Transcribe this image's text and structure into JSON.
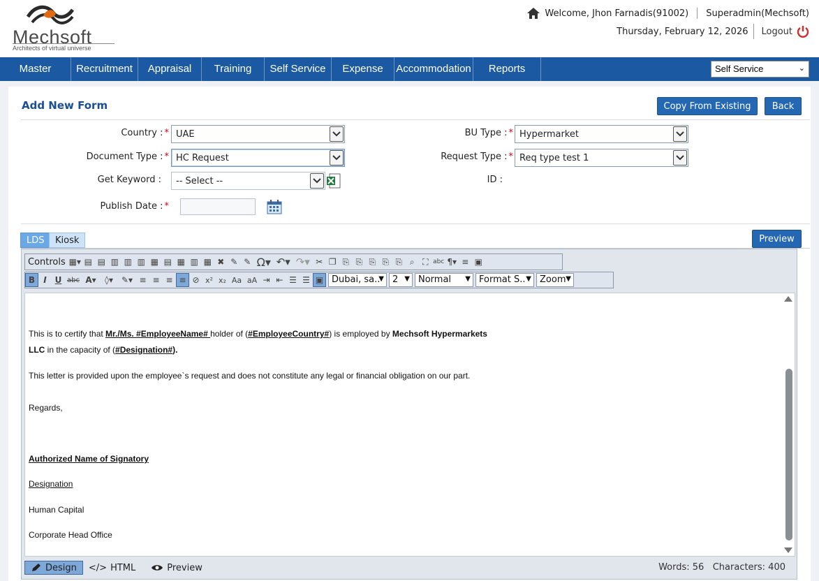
{
  "header": {
    "logo_name": "Mechsoft",
    "logo_tagline": "Architects of virtual universe",
    "welcome": "Welcome, Jhon Farnadis(91002)",
    "role": "Superadmin(Mechsoft)",
    "date": "Thursday, February 12, 2026",
    "logout": "Logout"
  },
  "nav": {
    "items": [
      "Master",
      "Recruitment",
      "Appraisal",
      "Training",
      "Self Service",
      "Expense",
      "Accommodation",
      "Reports"
    ],
    "module_select": "Self Service"
  },
  "page": {
    "title": "Add New Form",
    "copy_button": "Copy From Existing",
    "back_button": "Back",
    "preview_button": "Preview"
  },
  "form": {
    "country_label": "Country :",
    "country_value": "UAE",
    "doc_type_label": "Document Type :",
    "doc_type_value": "HC Request",
    "keyword_label": "Get Keyword :",
    "keyword_value": "-- Select --",
    "publish_label": "Publish Date :",
    "publish_value": "",
    "bu_type_label": "BU Type :",
    "bu_type_value": "Hypermarket",
    "request_type_label": "Request Type :",
    "request_type_value": "Req type test 1",
    "id_label": "ID :",
    "required_mark": "*"
  },
  "tabs": [
    "LDS",
    "Kiosk"
  ],
  "editor": {
    "controls_label": "Controls",
    "font_name": "Dubai, sa..",
    "font_size": "2",
    "paragraph": "Normal",
    "format": "Format S..",
    "zoom": "Zoom",
    "content": {
      "p1_a": "This is to certify that ",
      "p1_b": "Mr./Ms. #EmployeeName# ",
      "p1_c": "holder of (",
      "p1_d": "#EmployeeCountry#",
      "p1_e": ") is employed by ",
      "p1_f": "Mechsoft Hypermarkets",
      "p1_g": "LLC",
      "p1_h": " in the capacity of (",
      "p1_i": "#Designation#",
      "p1_j": ").",
      "p2": "This letter is provided upon the employee`s request and does not constitute any legal or financial obligation on our part.",
      "p3": "Regards,",
      "p4": "Authorized Name of Signatory",
      "p5": "Designation ",
      "p6": "Human Capital",
      "p7": "Corporate Head Office"
    },
    "modes": [
      "Design",
      "HTML",
      "Preview"
    ],
    "words": "Words: 56",
    "characters": "Characters: 400"
  }
}
